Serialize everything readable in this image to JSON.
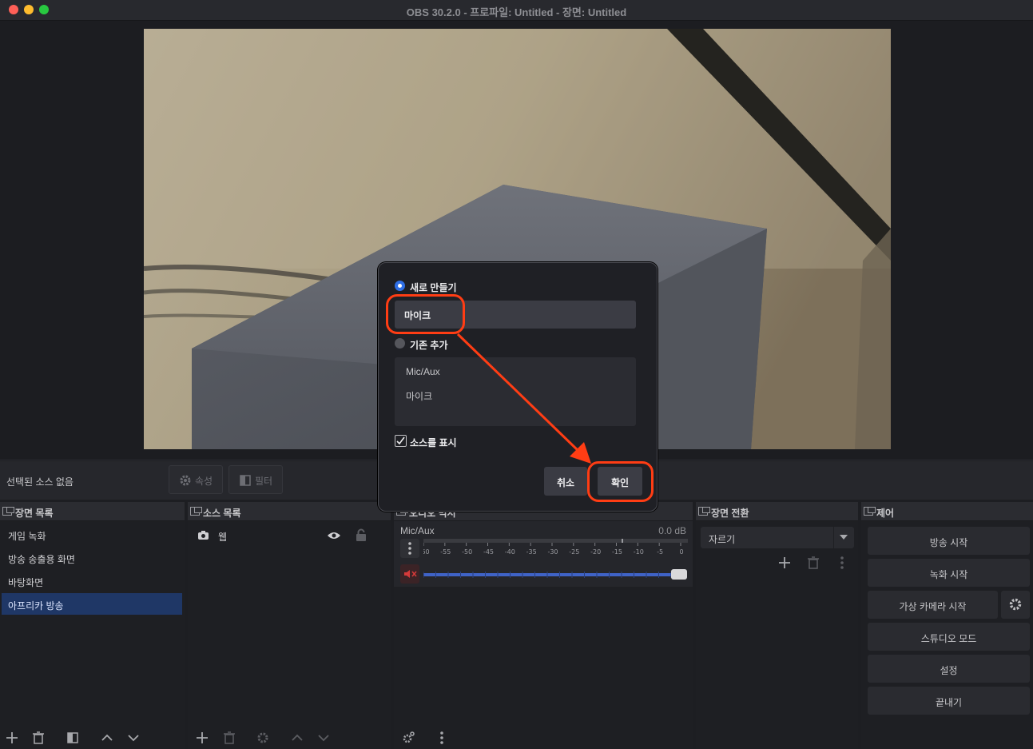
{
  "window": {
    "title": "OBS 30.2.0 - 프로파일: Untitled - 장면: Untitled"
  },
  "source_bar": {
    "no_source": "선택된 소스 없음",
    "properties": "속성",
    "filters": "필터"
  },
  "docks": {
    "scenes": {
      "title": "장면 목록",
      "items": [
        "게임 녹화",
        "방송 송출용 화면",
        "바탕화면",
        "아프리카 방송"
      ],
      "active_index": 3
    },
    "sources": {
      "title": "소스 목록",
      "items": [
        {
          "label": "웹",
          "icon": "camera-icon"
        }
      ]
    },
    "mixer": {
      "title": "오디오 믹서",
      "channel": {
        "name": "Mic/Aux",
        "db": "0.0 dB",
        "ticks": [
          "-60",
          "-55",
          "-50",
          "-45",
          "-40",
          "-35",
          "-30",
          "-25",
          "-20",
          "-15",
          "-10",
          "-5",
          "0"
        ],
        "volume": 1.0,
        "muted": true
      }
    },
    "transitions": {
      "title": "장면 전환",
      "selected": "자르기"
    },
    "controls": {
      "title": "제어",
      "buttons": [
        "방송 시작",
        "녹화 시작",
        "가상 카메라 시작",
        "스튜디오 모드",
        "설정",
        "끝내기"
      ]
    }
  },
  "dialog": {
    "create_new": "새로 만들기",
    "name_value": "마이크",
    "add_existing": "기존 추가",
    "existing_items": [
      "Mic/Aux",
      "마이크"
    ],
    "visible_checkbox": "소스를 표시",
    "visible_checked": true,
    "cancel": "취소",
    "ok": "확인"
  },
  "annotation": {
    "color": "#ff3d14"
  }
}
